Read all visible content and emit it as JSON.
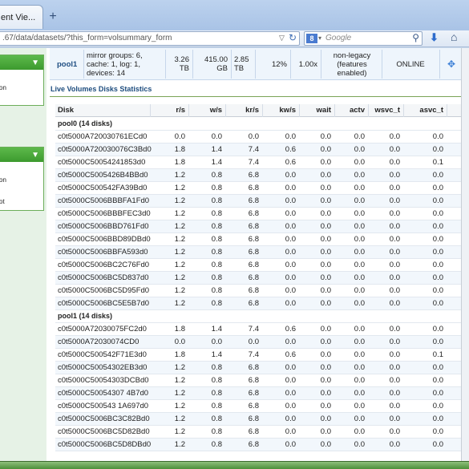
{
  "browser": {
    "tab_title": "ent Vie...",
    "tab_close_icon": "×",
    "new_tab_label": "+",
    "url": ".67/data/datasets/?this_form=volsummary_form",
    "search_placeholder": "Google",
    "search_engine_letter": "8"
  },
  "left_panels": [
    {
      "items": [
        "on"
      ]
    },
    {
      "items": [
        "on",
        "ot"
      ]
    }
  ],
  "summary": {
    "pool": "pool1",
    "description": "mirror groups: 6, cache: 1, log: 1, devices: 14",
    "size1": "3.26 TB",
    "size2": "415.00 GB",
    "size3": "2.85 TB",
    "percent": "12%",
    "ratio": "1.00x",
    "features": "non-legacy (features enabled)",
    "status": "ONLINE",
    "action_icon": "✥"
  },
  "section_title": "Live Volumes Disks Statistics",
  "table": {
    "columns": [
      "Disk",
      "r/s",
      "w/s",
      "kr/s",
      "kw/s",
      "wait",
      "actv",
      "wsvc_t",
      "asvc_t"
    ],
    "groups": [
      {
        "name": "pool0 (14 disks)",
        "rows": [
          [
            "c0t5000A720030761ECd0",
            "0.0",
            "0.0",
            "0.0",
            "0.0",
            "0.0",
            "0.0",
            "0.0",
            "0.0"
          ],
          [
            "c0t5000A720030076C3Bd0",
            "1.8",
            "1.4",
            "7.4",
            "0.6",
            "0.0",
            "0.0",
            "0.0",
            "0.0"
          ],
          [
            "c0t5000C50054241853d0",
            "1.8",
            "1.4",
            "7.4",
            "0.6",
            "0.0",
            "0.0",
            "0.0",
            "0.1"
          ],
          [
            "c0t5000C5005426B4BBd0",
            "1.2",
            "0.8",
            "6.8",
            "0.0",
            "0.0",
            "0.0",
            "0.0",
            "0.0"
          ],
          [
            "c0t5000C500542FA39Bd0",
            "1.2",
            "0.8",
            "6.8",
            "0.0",
            "0.0",
            "0.0",
            "0.0",
            "0.0"
          ],
          [
            "c0t5000C5006BBBFA1Fd0",
            "1.2",
            "0.8",
            "6.8",
            "0.0",
            "0.0",
            "0.0",
            "0.0",
            "0.0"
          ],
          [
            "c0t5000C5006BBBFEC3d0",
            "1.2",
            "0.8",
            "6.8",
            "0.0",
            "0.0",
            "0.0",
            "0.0",
            "0.0"
          ],
          [
            "c0t5000C5006BBD761Fd0",
            "1.2",
            "0.8",
            "6.8",
            "0.0",
            "0.0",
            "0.0",
            "0.0",
            "0.0"
          ],
          [
            "c0t5000C5006BBD89DBd0",
            "1.2",
            "0.8",
            "6.8",
            "0.0",
            "0.0",
            "0.0",
            "0.0",
            "0.0"
          ],
          [
            "c0t5000C5006BBFA593d0",
            "1.2",
            "0.8",
            "6.8",
            "0.0",
            "0.0",
            "0.0",
            "0.0",
            "0.0"
          ],
          [
            "c0t5000C5006BC2C76Fd0",
            "1.2",
            "0.8",
            "6.8",
            "0.0",
            "0.0",
            "0.0",
            "0.0",
            "0.0"
          ],
          [
            "c0t5000C5006BC5D837d0",
            "1.2",
            "0.8",
            "6.8",
            "0.0",
            "0.0",
            "0.0",
            "0.0",
            "0.0"
          ],
          [
            "c0t5000C5006BC5D95Fd0",
            "1.2",
            "0.8",
            "6.8",
            "0.0",
            "0.0",
            "0.0",
            "0.0",
            "0.0"
          ],
          [
            "c0t5000C5006BC5E5B7d0",
            "1.2",
            "0.8",
            "6.8",
            "0.0",
            "0.0",
            "0.0",
            "0.0",
            "0.0"
          ]
        ]
      },
      {
        "name": "pool1 (14 disks)",
        "rows": [
          [
            "c0t5000A72030075FC2d0",
            "1.8",
            "1.4",
            "7.4",
            "0.6",
            "0.0",
            "0.0",
            "0.0",
            "0.0"
          ],
          [
            "c0t5000A72030074CD0",
            "0.0",
            "0.0",
            "0.0",
            "0.0",
            "0.0",
            "0.0",
            "0.0",
            "0.0"
          ],
          [
            "c0t5000C500542F71E3d0",
            "1.8",
            "1.4",
            "7.4",
            "0.6",
            "0.0",
            "0.0",
            "0.0",
            "0.1"
          ],
          [
            "c0t5000C50054302EB3d0",
            "1.2",
            "0.8",
            "6.8",
            "0.0",
            "0.0",
            "0.0",
            "0.0",
            "0.0"
          ],
          [
            "c0t5000C50054303DCBd0",
            "1.2",
            "0.8",
            "6.8",
            "0.0",
            "0.0",
            "0.0",
            "0.0",
            "0.0"
          ],
          [
            "c0t5000C50054307 4B7d0",
            "1.2",
            "0.8",
            "6.8",
            "0.0",
            "0.0",
            "0.0",
            "0.0",
            "0.0"
          ],
          [
            "c0t5000C500543 1A697d0",
            "1.2",
            "0.8",
            "6.8",
            "0.0",
            "0.0",
            "0.0",
            "0.0",
            "0.0"
          ],
          [
            "c0t5000C5006BC3C82Bd0",
            "1.2",
            "0.8",
            "6.8",
            "0.0",
            "0.0",
            "0.0",
            "0.0",
            "0.0"
          ],
          [
            "c0t5000C5006BC5D82Bd0",
            "1.2",
            "0.8",
            "6.8",
            "0.0",
            "0.0",
            "0.0",
            "0.0",
            "0.0"
          ],
          [
            "c0t5000C5006BC5D8DBd0",
            "1.2",
            "0.8",
            "6.8",
            "0.0",
            "0.0",
            "0.0",
            "0.0",
            "0.0"
          ]
        ]
      }
    ]
  }
}
